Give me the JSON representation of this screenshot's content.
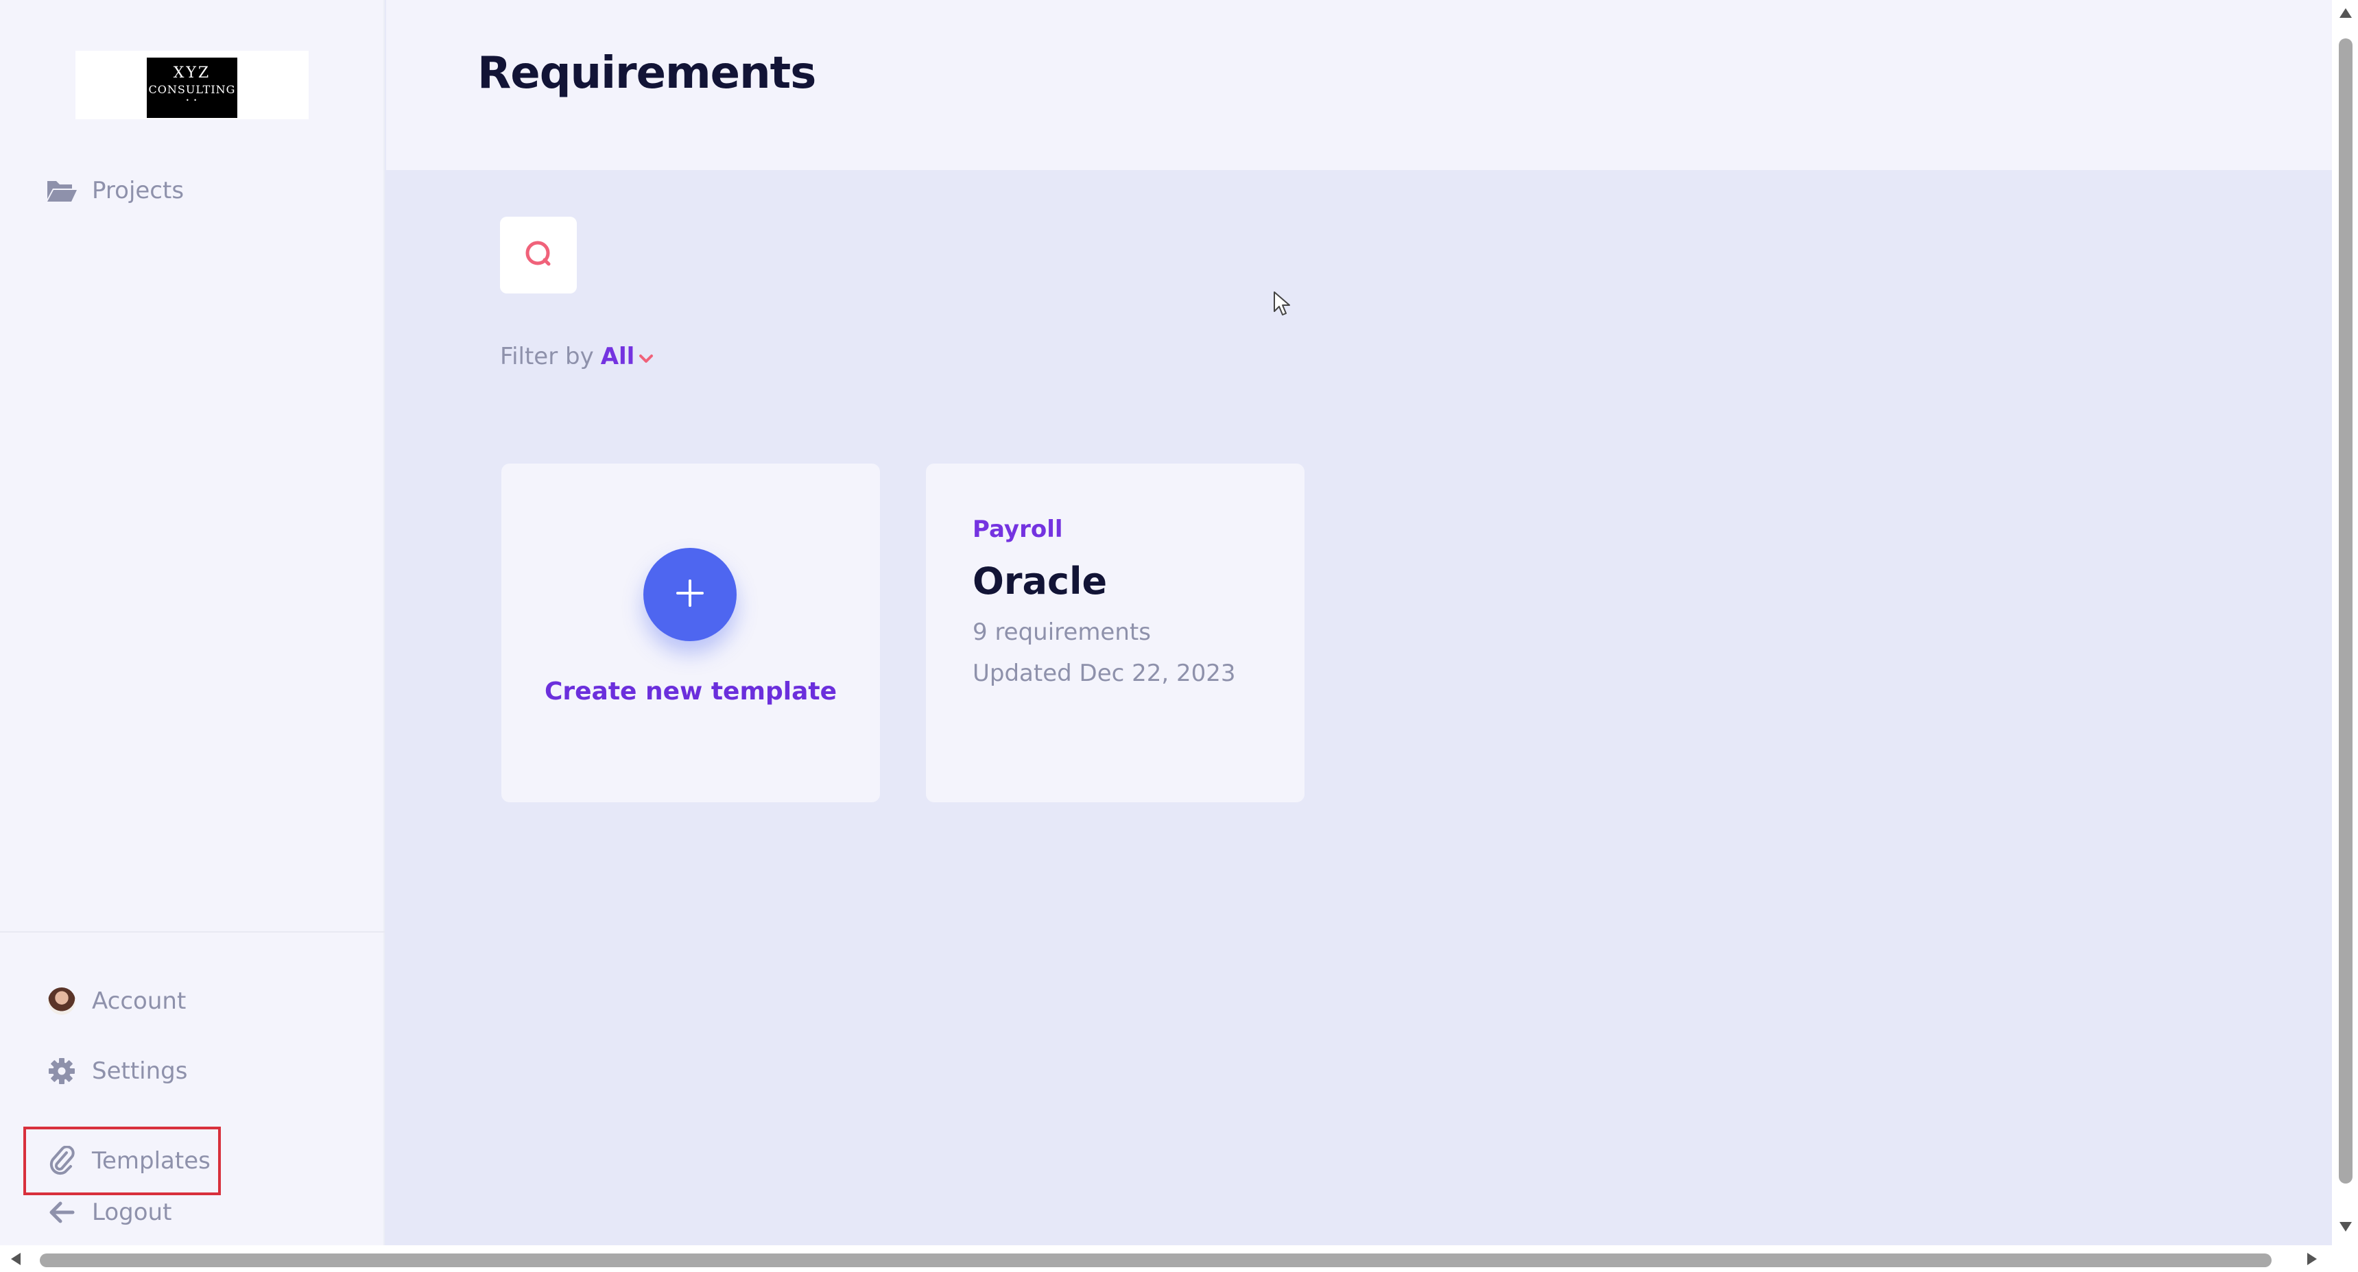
{
  "brand": {
    "logo_line1": "XYZ",
    "logo_line2": "CONSULTING",
    "logo_line3": "• •"
  },
  "sidebar": {
    "top_items": [
      {
        "label": "Projects",
        "icon": "folder-open-icon"
      }
    ],
    "bottom_items": [
      {
        "label": "Account",
        "icon": "avatar"
      },
      {
        "label": "Settings",
        "icon": "gear-icon"
      },
      {
        "label": "Templates",
        "icon": "paperclip-icon",
        "highlighted": true
      },
      {
        "label": "Logout",
        "icon": "arrow-left-icon"
      }
    ]
  },
  "header": {
    "title": "Requirements"
  },
  "main": {
    "search_icon": "search-icon",
    "filter": {
      "label": "Filter by",
      "value": "All"
    },
    "create_card": {
      "label": "Create new template"
    },
    "templates": [
      {
        "category": "Payroll",
        "title": "Oracle",
        "count_text": "9 requirements",
        "updated_text": "Updated Dec 22, 2023"
      }
    ]
  },
  "colors": {
    "accent_purple": "#7433e0",
    "primary_blue": "#4e66f0",
    "highlight_red": "#d8303c",
    "title_navy": "#121436",
    "muted_text": "#8e91ab"
  }
}
